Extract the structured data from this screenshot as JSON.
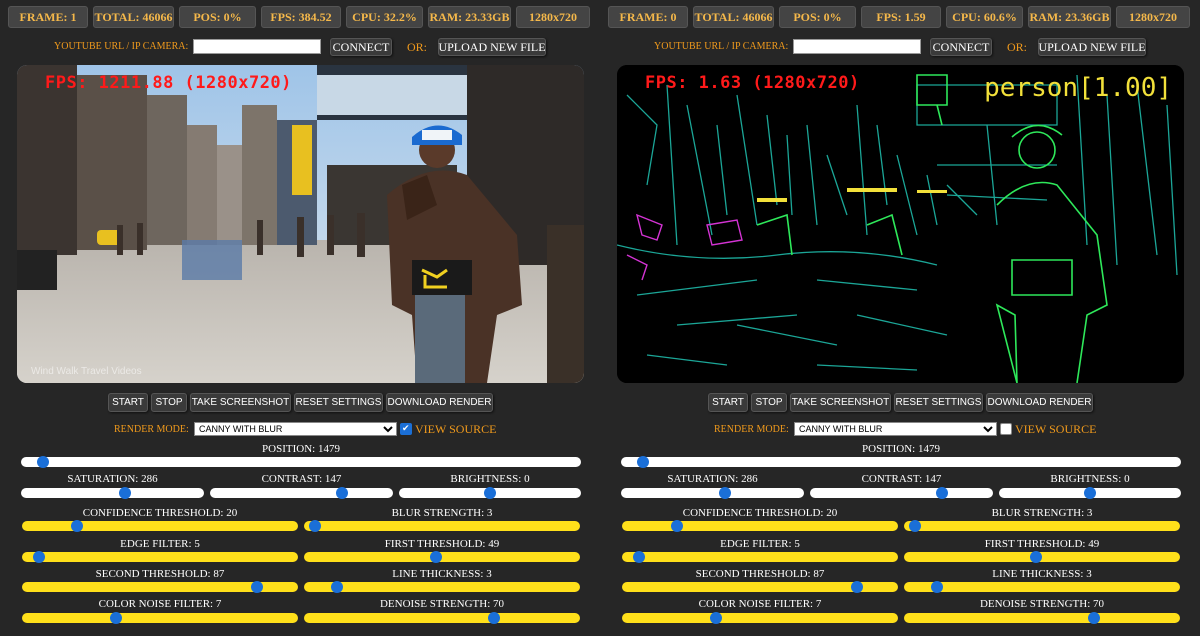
{
  "panels": [
    {
      "stats": {
        "frame": "FRAME: 1",
        "total": "TOTAL: 46066",
        "pos": "POS: 0%",
        "fps": "FPS: 384.52",
        "cpu": "CPU: 32.2%",
        "ram": "RAM: 23.33GB",
        "res": "1280x720"
      },
      "url_label": "YOUTUBE URL / IP CAMERA:",
      "url_value": "",
      "connect_label": "CONNECT",
      "or_label": "OR:",
      "upload_label": "UPLOAD NEW FILE",
      "video_fps": "FPS: 1211.88 (1280x720)",
      "watermark": "Wind Walk Travel Videos",
      "person_label": "",
      "buttons": {
        "start": "START",
        "stop": "STOP",
        "screenshot": "TAKE SCREENSHOT",
        "reset": "RESET SETTINGS",
        "download": "DOWNLOAD RENDER"
      },
      "render_mode_label": "RENDER MODE:",
      "render_mode_value": "CANNY WITH BLUR",
      "view_source_label": "VIEW SOURCE",
      "view_source_checked": true,
      "position": {
        "label": "POSITION: 1479",
        "fraction": 0.04
      },
      "sliders": {
        "saturation": {
          "label": "SATURATION: 286",
          "fraction": 0.57
        },
        "contrast": {
          "label": "CONTRAST: 147",
          "fraction": 0.72
        },
        "brightness": {
          "label": "BRIGHTNESS: 0",
          "fraction": 0.5
        },
        "confidence": {
          "label": "CONFIDENCE THRESHOLD: 20",
          "fraction": 0.2
        },
        "blur": {
          "label": "BLUR STRENGTH: 3",
          "fraction": 0.04
        },
        "edge": {
          "label": "EDGE FILTER: 5",
          "fraction": 0.06
        },
        "first": {
          "label": "FIRST THRESHOLD: 49",
          "fraction": 0.48
        },
        "second": {
          "label": "SECOND THRESHOLD: 87",
          "fraction": 0.85
        },
        "line": {
          "label": "LINE THICKNESS: 3",
          "fraction": 0.12
        },
        "noise": {
          "label": "COLOR NOISE FILTER: 7",
          "fraction": 0.34
        },
        "denoise": {
          "label": "DENOISE STRENGTH: 70",
          "fraction": 0.69
        }
      }
    },
    {
      "stats": {
        "frame": "FRAME: 0",
        "total": "TOTAL: 46066",
        "pos": "POS: 0%",
        "fps": "FPS: 1.59",
        "cpu": "CPU: 60.6%",
        "ram": "RAM: 23.36GB",
        "res": "1280x720"
      },
      "url_label": "YOUTUBE URL / IP CAMERA:",
      "url_value": "",
      "connect_label": "CONNECT",
      "or_label": "OR:",
      "upload_label": "UPLOAD NEW FILE",
      "video_fps": "FPS: 1.63 (1280x720)",
      "watermark": "",
      "person_label": "person[1.00]",
      "buttons": {
        "start": "START",
        "stop": "STOP",
        "screenshot": "TAKE SCREENSHOT",
        "reset": "RESET SETTINGS",
        "download": "DOWNLOAD RENDER"
      },
      "render_mode_label": "RENDER MODE:",
      "render_mode_value": "CANNY WITH BLUR",
      "view_source_label": "VIEW SOURCE",
      "view_source_checked": false,
      "position": {
        "label": "POSITION: 1479",
        "fraction": 0.04
      },
      "sliders": {
        "saturation": {
          "label": "SATURATION: 286",
          "fraction": 0.57
        },
        "contrast": {
          "label": "CONTRAST: 147",
          "fraction": 0.72
        },
        "brightness": {
          "label": "BRIGHTNESS: 0",
          "fraction": 0.5
        },
        "confidence": {
          "label": "CONFIDENCE THRESHOLD: 20",
          "fraction": 0.2
        },
        "blur": {
          "label": "BLUR STRENGTH: 3",
          "fraction": 0.04
        },
        "edge": {
          "label": "EDGE FILTER: 5",
          "fraction": 0.06
        },
        "first": {
          "label": "FIRST THRESHOLD: 49",
          "fraction": 0.48
        },
        "second": {
          "label": "SECOND THRESHOLD: 87",
          "fraction": 0.85
        },
        "line": {
          "label": "LINE THICKNESS: 3",
          "fraction": 0.12
        },
        "noise": {
          "label": "COLOR NOISE FILTER: 7",
          "fraction": 0.34
        },
        "denoise": {
          "label": "DENOISE STRENGTH: 70",
          "fraction": 0.69
        }
      }
    }
  ]
}
